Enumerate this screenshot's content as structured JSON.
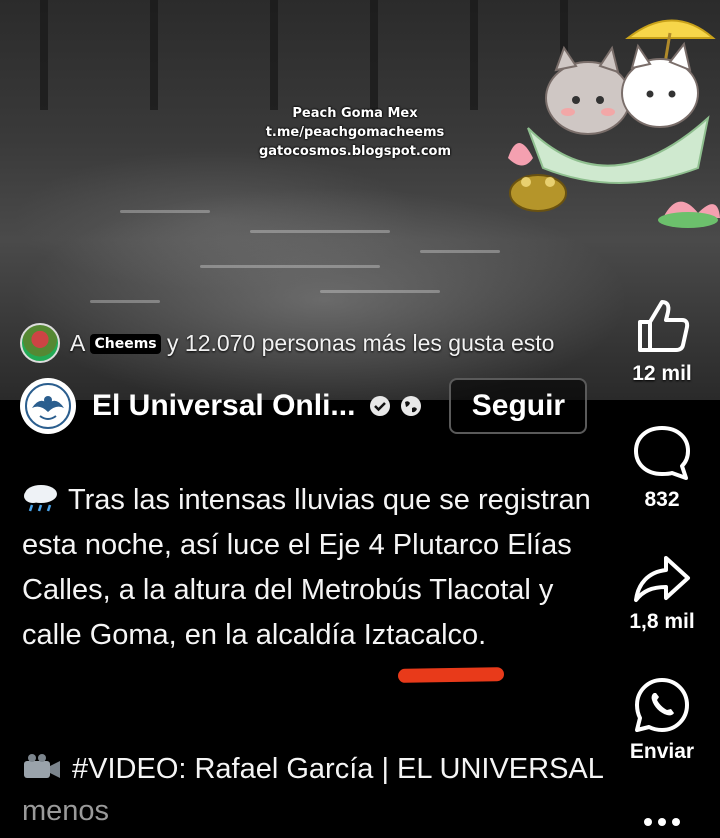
{
  "watermark": {
    "line1": "Peach Goma Mex",
    "line2": "t.me/peachgomacheems",
    "line3": "gatocosmos.blogspot.com"
  },
  "likes": {
    "prefix": "A ",
    "tag": "Cheems",
    "suffix": "y 12.070 personas más les gusta esto"
  },
  "page": {
    "name": "El Universal Onli...",
    "follow_label": "Seguir"
  },
  "caption": {
    "text": "Tras las intensas lluvias que se registran esta noche, así luce el Eje 4 Plutarco Elías Calles, a la altura del Metrobús Tlacotal y calle Goma, en la alcaldía Iztacalco."
  },
  "credit": {
    "text": "#VIDEO: Rafael García | EL UNIVERSAL",
    "more": "menos"
  },
  "rail": {
    "like_count": "12 mil",
    "comment_count": "832",
    "share_count": "1,8 mil",
    "whatsapp_label": "Enviar"
  },
  "colors": {
    "background": "#000000",
    "highlight_mark": "#e83a1a",
    "muted_text": "#9a9a9a"
  },
  "icons": [
    "cloud-rain-icon",
    "verified-icon",
    "globe-icon",
    "thumbs-up-icon",
    "comment-icon",
    "share-icon",
    "whatsapp-icon",
    "more-icon",
    "video-camera-icon"
  ]
}
